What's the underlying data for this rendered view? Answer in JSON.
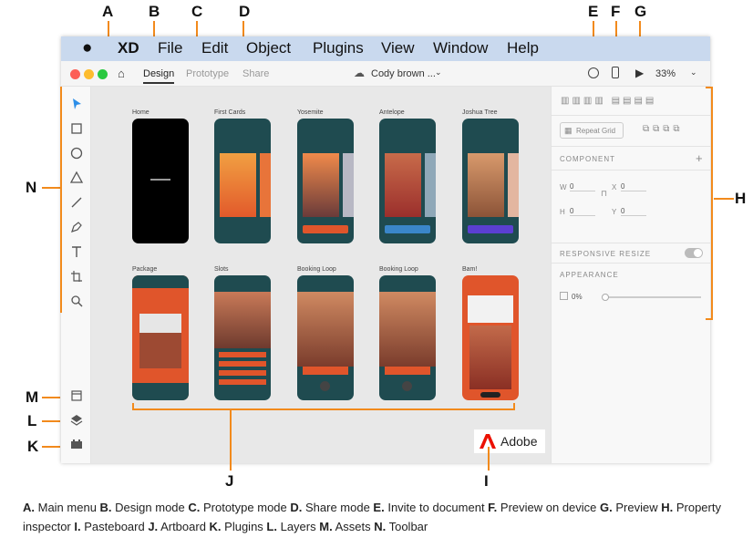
{
  "callouts": {
    "a": "A",
    "b": "B",
    "c": "C",
    "d": "D",
    "e": "E",
    "f": "F",
    "g": "G",
    "h": "H",
    "i": "I",
    "j": "J",
    "k": "K",
    "l": "L",
    "m": "M",
    "n": "N"
  },
  "menubar": {
    "app": "XD",
    "items": [
      "File",
      "Edit",
      "Object",
      "Plugins",
      "View",
      "Window",
      "Help"
    ]
  },
  "titlebar": {
    "tabs": [
      "Design",
      "Prototype",
      "Share"
    ],
    "doc_name": "Cody brown ...",
    "zoom": "33%"
  },
  "artboards": [
    {
      "name": "Home"
    },
    {
      "name": "First Cards"
    },
    {
      "name": "Yosemite"
    },
    {
      "name": "Antelope"
    },
    {
      "name": "Joshua Tree"
    },
    {
      "name": "Package"
    },
    {
      "name": "Slots"
    },
    {
      "name": "Booking Loop"
    },
    {
      "name": "Booking Loop"
    },
    {
      "name": "Bam!"
    }
  ],
  "inspector": {
    "repeat_grid": "Repeat Grid",
    "component": "COMPONENT",
    "w_label": "W",
    "w_val": "0",
    "x_label": "X",
    "x_val": "0",
    "h_label": "H",
    "h_val": "0",
    "y_label": "Y",
    "y_val": "0",
    "responsive": "RESPONSIVE RESIZE",
    "appearance": "APPEARANCE",
    "opacity": "0%"
  },
  "brand": "Adobe",
  "colors": {
    "accent": "#f28a1c",
    "menubar": "#c9d9ee",
    "adobe_red": "#eb1000",
    "teal": "#1d4a4f",
    "orange": "#e0552b"
  },
  "caption": [
    {
      "k": "A.",
      "t": " Main menu "
    },
    {
      "k": "B.",
      "t": " Design mode "
    },
    {
      "k": "C.",
      "t": " Prototype mode "
    },
    {
      "k": "D.",
      "t": " Share mode "
    },
    {
      "k": "E.",
      "t": " Invite to document "
    },
    {
      "k": "F.",
      "t": " Preview on device "
    },
    {
      "k": "G.",
      "t": " Preview "
    },
    {
      "k": "H.",
      "t": " Property inspector "
    },
    {
      "k": "I.",
      "t": " Pasteboard "
    },
    {
      "k": "J.",
      "t": " Artboard "
    },
    {
      "k": "K.",
      "t": " Plugins "
    },
    {
      "k": "L.",
      "t": " Layers "
    },
    {
      "k": "M.",
      "t": " Assets "
    },
    {
      "k": "N.",
      "t": " Toolbar"
    }
  ]
}
